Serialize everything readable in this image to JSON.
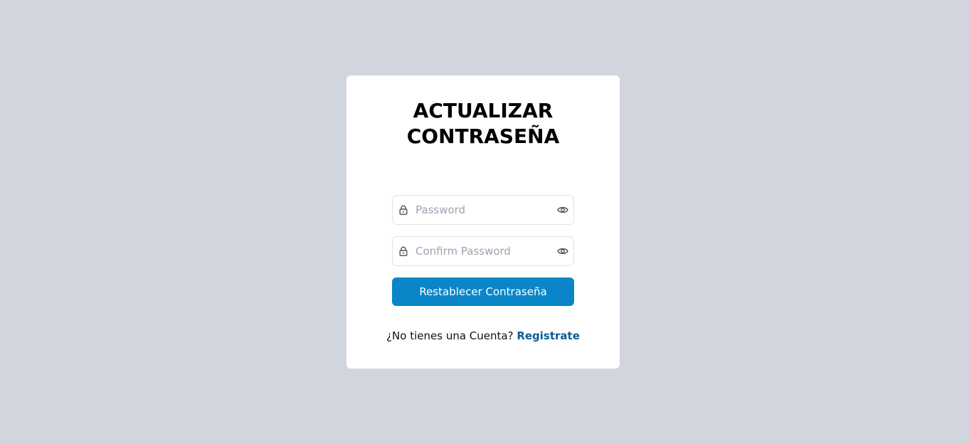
{
  "form": {
    "title": "ACTUALIZAR\nCONTRASEÑA",
    "password": {
      "placeholder": "Password",
      "value": "",
      "icon_left": "lock-icon",
      "icon_right": "eye-icon"
    },
    "confirm_password": {
      "placeholder": "Confirm Password",
      "value": "",
      "icon_left": "lock-icon",
      "icon_right": "eye-icon"
    },
    "submit_label": "Restablecer Contraseña",
    "footer": {
      "prompt": "¿No tienes una Cuenta?",
      "link_label": "Registrate"
    }
  },
  "colors": {
    "background": "#d1d5dd",
    "card": "#ffffff",
    "button": "#0a86c8",
    "link": "#0b5d95"
  }
}
